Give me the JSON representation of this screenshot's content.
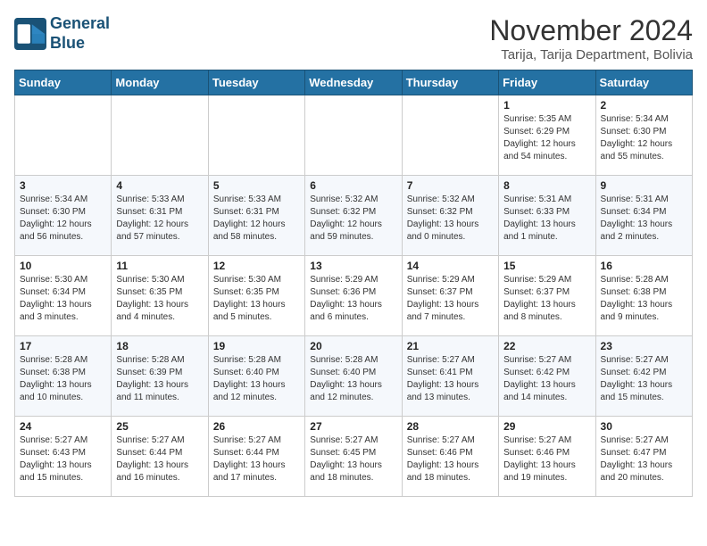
{
  "logo": {
    "line1": "General",
    "line2": "Blue"
  },
  "title": "November 2024",
  "subtitle": "Tarija, Tarija Department, Bolivia",
  "weekdays": [
    "Sunday",
    "Monday",
    "Tuesday",
    "Wednesday",
    "Thursday",
    "Friday",
    "Saturday"
  ],
  "weeks": [
    [
      {
        "day": "",
        "info": ""
      },
      {
        "day": "",
        "info": ""
      },
      {
        "day": "",
        "info": ""
      },
      {
        "day": "",
        "info": ""
      },
      {
        "day": "",
        "info": ""
      },
      {
        "day": "1",
        "info": "Sunrise: 5:35 AM\nSunset: 6:29 PM\nDaylight: 12 hours and 54 minutes."
      },
      {
        "day": "2",
        "info": "Sunrise: 5:34 AM\nSunset: 6:30 PM\nDaylight: 12 hours and 55 minutes."
      }
    ],
    [
      {
        "day": "3",
        "info": "Sunrise: 5:34 AM\nSunset: 6:30 PM\nDaylight: 12 hours and 56 minutes."
      },
      {
        "day": "4",
        "info": "Sunrise: 5:33 AM\nSunset: 6:31 PM\nDaylight: 12 hours and 57 minutes."
      },
      {
        "day": "5",
        "info": "Sunrise: 5:33 AM\nSunset: 6:31 PM\nDaylight: 12 hours and 58 minutes."
      },
      {
        "day": "6",
        "info": "Sunrise: 5:32 AM\nSunset: 6:32 PM\nDaylight: 12 hours and 59 minutes."
      },
      {
        "day": "7",
        "info": "Sunrise: 5:32 AM\nSunset: 6:32 PM\nDaylight: 13 hours and 0 minutes."
      },
      {
        "day": "8",
        "info": "Sunrise: 5:31 AM\nSunset: 6:33 PM\nDaylight: 13 hours and 1 minute."
      },
      {
        "day": "9",
        "info": "Sunrise: 5:31 AM\nSunset: 6:34 PM\nDaylight: 13 hours and 2 minutes."
      }
    ],
    [
      {
        "day": "10",
        "info": "Sunrise: 5:30 AM\nSunset: 6:34 PM\nDaylight: 13 hours and 3 minutes."
      },
      {
        "day": "11",
        "info": "Sunrise: 5:30 AM\nSunset: 6:35 PM\nDaylight: 13 hours and 4 minutes."
      },
      {
        "day": "12",
        "info": "Sunrise: 5:30 AM\nSunset: 6:35 PM\nDaylight: 13 hours and 5 minutes."
      },
      {
        "day": "13",
        "info": "Sunrise: 5:29 AM\nSunset: 6:36 PM\nDaylight: 13 hours and 6 minutes."
      },
      {
        "day": "14",
        "info": "Sunrise: 5:29 AM\nSunset: 6:37 PM\nDaylight: 13 hours and 7 minutes."
      },
      {
        "day": "15",
        "info": "Sunrise: 5:29 AM\nSunset: 6:37 PM\nDaylight: 13 hours and 8 minutes."
      },
      {
        "day": "16",
        "info": "Sunrise: 5:28 AM\nSunset: 6:38 PM\nDaylight: 13 hours and 9 minutes."
      }
    ],
    [
      {
        "day": "17",
        "info": "Sunrise: 5:28 AM\nSunset: 6:38 PM\nDaylight: 13 hours and 10 minutes."
      },
      {
        "day": "18",
        "info": "Sunrise: 5:28 AM\nSunset: 6:39 PM\nDaylight: 13 hours and 11 minutes."
      },
      {
        "day": "19",
        "info": "Sunrise: 5:28 AM\nSunset: 6:40 PM\nDaylight: 13 hours and 12 minutes."
      },
      {
        "day": "20",
        "info": "Sunrise: 5:28 AM\nSunset: 6:40 PM\nDaylight: 13 hours and 12 minutes."
      },
      {
        "day": "21",
        "info": "Sunrise: 5:27 AM\nSunset: 6:41 PM\nDaylight: 13 hours and 13 minutes."
      },
      {
        "day": "22",
        "info": "Sunrise: 5:27 AM\nSunset: 6:42 PM\nDaylight: 13 hours and 14 minutes."
      },
      {
        "day": "23",
        "info": "Sunrise: 5:27 AM\nSunset: 6:42 PM\nDaylight: 13 hours and 15 minutes."
      }
    ],
    [
      {
        "day": "24",
        "info": "Sunrise: 5:27 AM\nSunset: 6:43 PM\nDaylight: 13 hours and 15 minutes."
      },
      {
        "day": "25",
        "info": "Sunrise: 5:27 AM\nSunset: 6:44 PM\nDaylight: 13 hours and 16 minutes."
      },
      {
        "day": "26",
        "info": "Sunrise: 5:27 AM\nSunset: 6:44 PM\nDaylight: 13 hours and 17 minutes."
      },
      {
        "day": "27",
        "info": "Sunrise: 5:27 AM\nSunset: 6:45 PM\nDaylight: 13 hours and 18 minutes."
      },
      {
        "day": "28",
        "info": "Sunrise: 5:27 AM\nSunset: 6:46 PM\nDaylight: 13 hours and 18 minutes."
      },
      {
        "day": "29",
        "info": "Sunrise: 5:27 AM\nSunset: 6:46 PM\nDaylight: 13 hours and 19 minutes."
      },
      {
        "day": "30",
        "info": "Sunrise: 5:27 AM\nSunset: 6:47 PM\nDaylight: 13 hours and 20 minutes."
      }
    ]
  ]
}
